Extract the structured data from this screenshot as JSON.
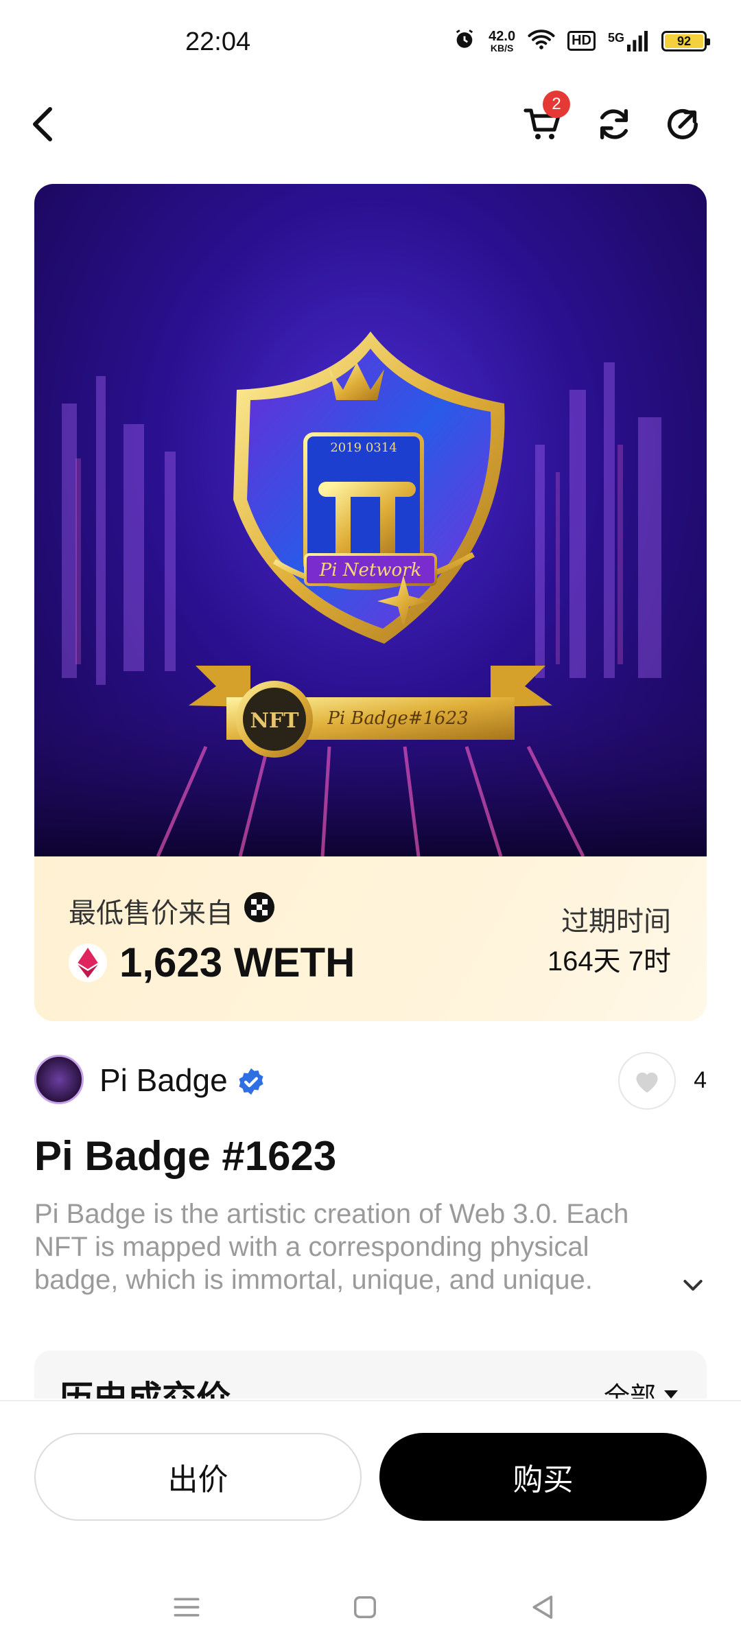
{
  "status_bar": {
    "time": "22:04",
    "net_speed_value": "42.0",
    "net_speed_unit": "KB/S",
    "hd_label": "HD",
    "signal_label": "5G",
    "battery_level": "92",
    "icons": [
      "alarm-icon",
      "wifi-icon",
      "signal-icon",
      "battery-icon"
    ]
  },
  "nav": {
    "icons": [
      "back-icon",
      "cart-icon",
      "refresh-icon",
      "share-icon"
    ],
    "cart_count": "2"
  },
  "nft_art": {
    "ribbon_text": "Pi Badge#1623",
    "seal_text": "NFT",
    "shield_text": "Pi Network",
    "shield_date": "2019 0314"
  },
  "price": {
    "label": "最低售价来自",
    "value": "1,623 WETH",
    "currency_icon": "eth-icon",
    "expire_label": "过期时间",
    "expire_value": "164天 7时"
  },
  "collection": {
    "name": "Pi Badge",
    "verified": true,
    "like_count": "4"
  },
  "item": {
    "title": "Pi Badge #1623",
    "description": "Pi Badge is the artistic creation of Web 3.0. Each NFT is mapped with a corresponding physical badge, which is immortal, unique, and unique."
  },
  "history": {
    "title": "历史成交价",
    "filter": "全部"
  },
  "actions": {
    "bid_label": "出价",
    "buy_label": "购买"
  },
  "colors": {
    "accent_dark": "#000000",
    "price_panel": "#fff3d6",
    "badge_red": "#e53935",
    "verified_blue": "#2f6fe4",
    "art_purple": "#2a108f"
  }
}
